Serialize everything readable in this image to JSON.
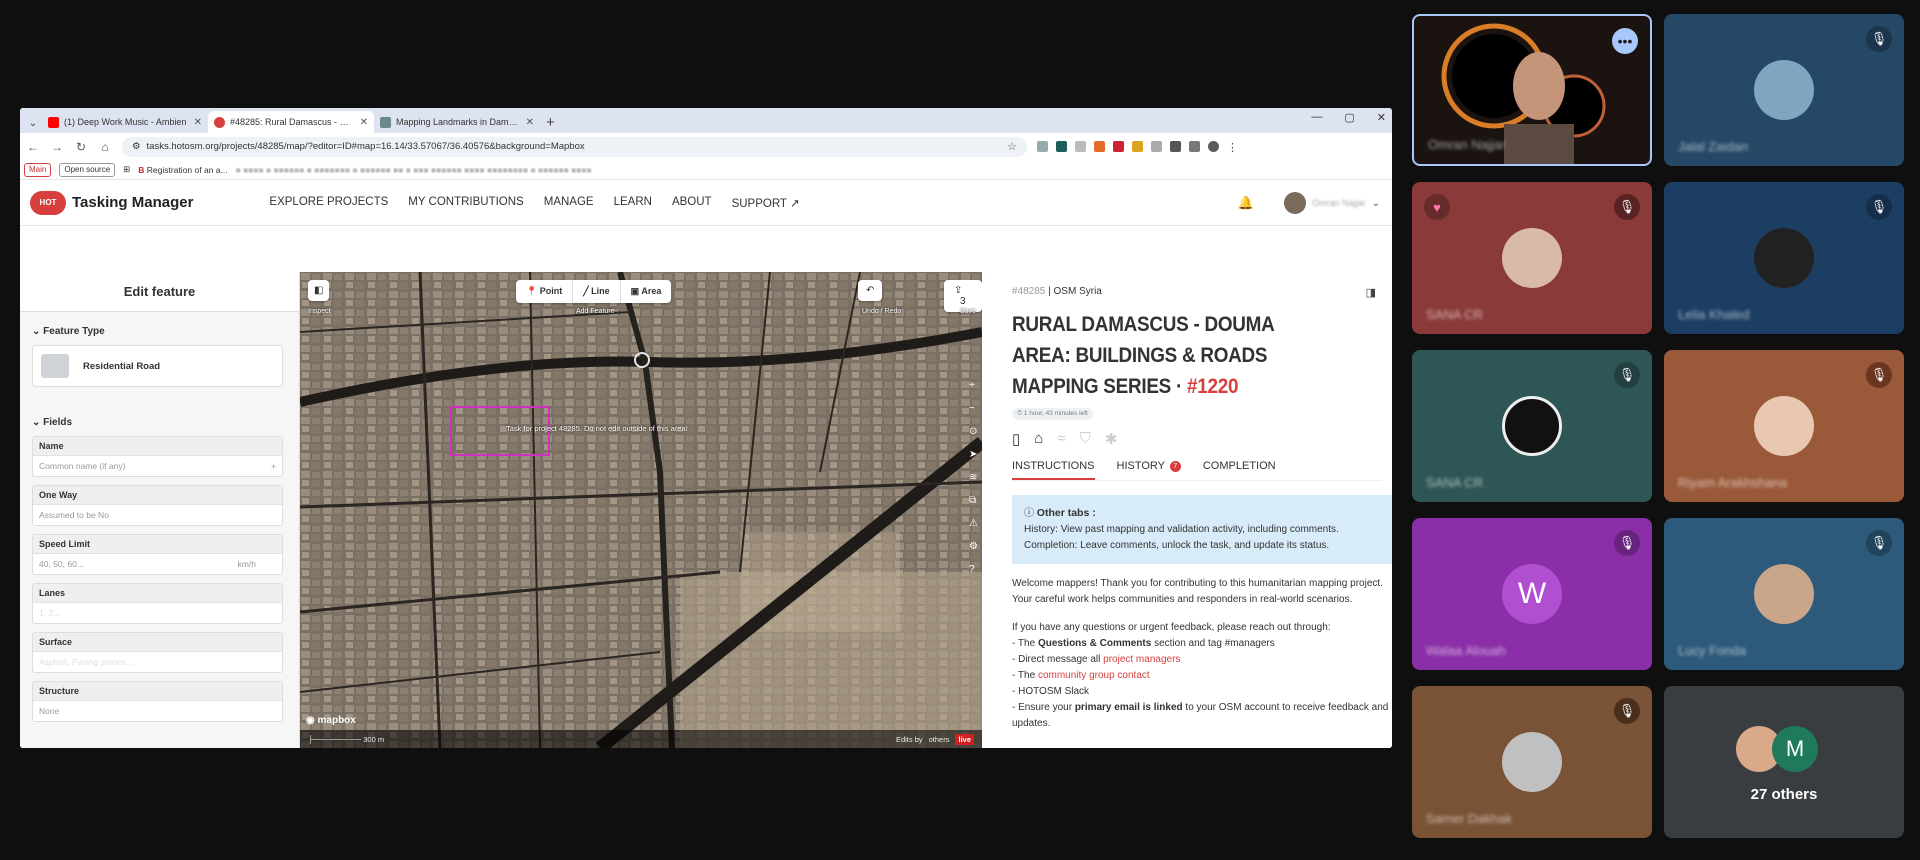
{
  "browser": {
    "tabs": [
      {
        "title": "(1) Deep Work Music - Ambien",
        "favicon_color": "#ff0000",
        "active": false
      },
      {
        "title": "#48285: Rural Damascus - Dou",
        "favicon_color": "#d73f3f",
        "active": true
      },
      {
        "title": "Mapping Landmarks in Damasc",
        "favicon_color": "#6a8a8a",
        "active": false
      }
    ],
    "url": "tasks.hotosm.org/projects/48285/map/?editor=ID#map=16.14/33.57067/36.40576&background=Mapbox",
    "bookmarks": {
      "main": "Main",
      "open_source": "Open source",
      "registration": "Registration of an a..."
    }
  },
  "tm": {
    "logo_badge": "HOT",
    "logo_text": "Tasking Manager",
    "nav": [
      "EXPLORE PROJECTS",
      "MY CONTRIBUTIONS",
      "MANAGE",
      "LEARN",
      "ABOUT",
      "SUPPORT"
    ],
    "user_name": "Omran Najjar"
  },
  "editor": {
    "title": "Edit feature",
    "feature_type_heading": "Feature Type",
    "feature_type": "Residential Road",
    "fields_heading": "Fields",
    "fields": [
      {
        "label": "Name",
        "value": "Common name (if any)"
      },
      {
        "label": "One Way",
        "value": "Assumed to be No"
      },
      {
        "label": "Speed Limit",
        "value": "40, 50, 60...",
        "unit": "km/h"
      },
      {
        "label": "Lanes",
        "value": "1, 2..."
      },
      {
        "label": "Surface",
        "value": "Asphalt, Paving stones..."
      },
      {
        "label": "Structure",
        "value": "None"
      }
    ]
  },
  "map": {
    "inspect_label": "Inspect",
    "tools": [
      "Point",
      "Line",
      "Area"
    ],
    "add_feature_label": "Add Feature",
    "undo_redo_label": "Undo / Redo",
    "save_label": "Save",
    "save_count": "3",
    "task_label": "Task for project 48285. Do not edit outside of this area!",
    "scale": "300 m",
    "mapbox": "mapbox",
    "edits_text": "Edits by",
    "others_text": "others",
    "live": "live"
  },
  "info": {
    "project_id": "#48285",
    "org": "OSM Syria",
    "title": "RURAL DAMASCUS - DOUMA AREA: BUILDINGS & ROADS MAPPING SERIES ·",
    "number": "#1220",
    "time_left": "1 hour, 43 minutes left",
    "tabs": [
      "INSTRUCTIONS",
      "HISTORY",
      "COMPLETION"
    ],
    "history_badge": "7",
    "note_title": "Other tabs :",
    "note_history_label": "History:",
    "note_history": "View past mapping and validation activity, including comments.",
    "note_completion_label": "Completion:",
    "note_completion": "Leave comments, unlock the task, and update its status.",
    "welcome": "Welcome mappers! Thank you for contributing to this humanitarian mapping project. Your careful work helps communities and responders in real-world scenarios.",
    "questions": "If you have any questions or urgent feedback, please reach out through:",
    "bullet1_pre": "- The",
    "bullet1_bold": "Questions & Comments",
    "bullet1_post": "section and tag #managers",
    "bullet2_pre": "- Direct message all",
    "bullet2_link": "project managers",
    "bullet3_pre": "- The",
    "bullet3_link": "community group contact",
    "bullet4": "- HOTOSM Slack",
    "bullet5_pre": "- Ensure your",
    "bullet5_bold": "primary email is linked",
    "bullet5_post": "to your OSM account to receive feedback and updates."
  },
  "participants": [
    {
      "name": "Omran Najjar",
      "bg": "#1a1310",
      "mic_muted": false
    },
    {
      "name": "Jalal Zaidan",
      "bg": "#244866",
      "mic_muted": true
    },
    {
      "name": "SANA CR",
      "bg": "#8b3a3a",
      "mic_muted": true
    },
    {
      "name": "Lelia Khaled",
      "bg": "#1d3e63",
      "mic_muted": true
    },
    {
      "name": "SANA CR",
      "bg": "#2f5656",
      "mic_muted": true
    },
    {
      "name": "Riyam Arakhshana",
      "bg": "#9a5a3a",
      "mic_muted": true
    },
    {
      "name": "Walaa Alouah",
      "bg": "#8a2fa8",
      "letter": "W",
      "mic_muted": true
    },
    {
      "name": "Lucy Fonda",
      "bg": "#2d5a7a",
      "mic_muted": true
    },
    {
      "name": "Samer Dakhak",
      "bg": "#7a5236",
      "mic_muted": true
    }
  ],
  "others": {
    "letter": "M",
    "label": "27 others"
  }
}
